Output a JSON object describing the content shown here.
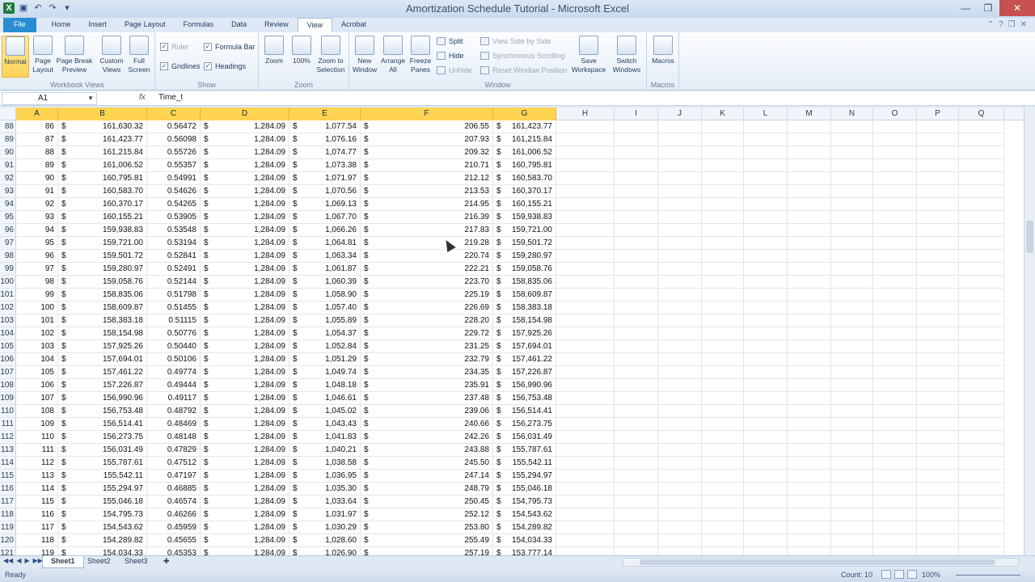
{
  "window": {
    "title": "Amortization Schedule Tutorial - Microsoft Excel"
  },
  "tabs": [
    "File",
    "Home",
    "Insert",
    "Page Layout",
    "Formulas",
    "Data",
    "Review",
    "View",
    "Acrobat"
  ],
  "active_tab": "View",
  "ribbon": {
    "workbook_views": {
      "label": "Workbook Views",
      "normal": "Normal",
      "page_layout": "Page Layout",
      "page_break": "Page Break Preview",
      "custom_views": "Custom Views",
      "full_screen": "Full Screen"
    },
    "show": {
      "label": "Show",
      "ruler": "Ruler",
      "formula_bar": "Formula Bar",
      "gridlines": "Gridlines",
      "headings": "Headings"
    },
    "zoom": {
      "label": "Zoom",
      "zoom": "Zoom",
      "pct100": "100%",
      "zoom_sel": "Zoom to Selection"
    },
    "window": {
      "label": "Window",
      "new_window": "New Window",
      "arrange_all": "Arrange All",
      "freeze_panes": "Freeze Panes",
      "split": "Split",
      "hide": "Hide",
      "unhide": "Unhide",
      "view_side": "View Side by Side",
      "sync_scroll": "Synchronous Scrolling",
      "reset_pos": "Reset Window Position",
      "save_ws": "Save Workspace",
      "switch_windows": "Switch Windows"
    },
    "macros": {
      "label": "Macros",
      "macros": "Macros"
    }
  },
  "formula_bar": {
    "name_box": "A1",
    "fx": "fx",
    "formula": "Time_t"
  },
  "columns": [
    "A",
    "B",
    "C",
    "D",
    "E",
    "F",
    "G",
    "H",
    "I",
    "J",
    "K",
    "L",
    "M",
    "N",
    "O",
    "P",
    "Q"
  ],
  "currency_symbol": "$",
  "rows": [
    {
      "r": "88",
      "a": "86",
      "b": "161,630.32",
      "c": "0.56472",
      "d": "1,284.09",
      "e": "1,077.54",
      "f": "206.55",
      "g": "161,423.77"
    },
    {
      "r": "89",
      "a": "87",
      "b": "161,423.77",
      "c": "0.56098",
      "d": "1,284.09",
      "e": "1,076.16",
      "f": "207.93",
      "g": "161,215.84"
    },
    {
      "r": "90",
      "a": "88",
      "b": "161,215.84",
      "c": "0.55726",
      "d": "1,284.09",
      "e": "1,074.77",
      "f": "209.32",
      "g": "161,006.52"
    },
    {
      "r": "91",
      "a": "89",
      "b": "161,006.52",
      "c": "0.55357",
      "d": "1,284.09",
      "e": "1,073.38",
      "f": "210.71",
      "g": "160,795.81"
    },
    {
      "r": "92",
      "a": "90",
      "b": "160,795.81",
      "c": "0.54991",
      "d": "1,284.09",
      "e": "1,071.97",
      "f": "212.12",
      "g": "160,583.70"
    },
    {
      "r": "93",
      "a": "91",
      "b": "160,583.70",
      "c": "0.54626",
      "d": "1,284.09",
      "e": "1,070.56",
      "f": "213.53",
      "g": "160,370.17"
    },
    {
      "r": "94",
      "a": "92",
      "b": "160,370.17",
      "c": "0.54265",
      "d": "1,284.09",
      "e": "1,069.13",
      "f": "214.95",
      "g": "160,155.21"
    },
    {
      "r": "95",
      "a": "93",
      "b": "160,155.21",
      "c": "0.53905",
      "d": "1,284.09",
      "e": "1,067.70",
      "f": "216.39",
      "g": "159,938.83"
    },
    {
      "r": "96",
      "a": "94",
      "b": "159,938.83",
      "c": "0.53548",
      "d": "1,284.09",
      "e": "1,066.26",
      "f": "217.83",
      "g": "159,721.00"
    },
    {
      "r": "97",
      "a": "95",
      "b": "159,721.00",
      "c": "0.53194",
      "d": "1,284.09",
      "e": "1,064.81",
      "f": "219.28",
      "g": "159,501.72"
    },
    {
      "r": "98",
      "a": "96",
      "b": "159,501.72",
      "c": "0.52841",
      "d": "1,284.09",
      "e": "1,063.34",
      "f": "220.74",
      "g": "159,280.97"
    },
    {
      "r": "99",
      "a": "97",
      "b": "159,280.97",
      "c": "0.52491",
      "d": "1,284.09",
      "e": "1,061.87",
      "f": "222.21",
      "g": "159,058.76"
    },
    {
      "r": "100",
      "a": "98",
      "b": "159,058.76",
      "c": "0.52144",
      "d": "1,284.09",
      "e": "1,060.39",
      "f": "223.70",
      "g": "158,835.06"
    },
    {
      "r": "101",
      "a": "99",
      "b": "158,835.06",
      "c": "0.51798",
      "d": "1,284.09",
      "e": "1,058.90",
      "f": "225.19",
      "g": "158,609.87"
    },
    {
      "r": "102",
      "a": "100",
      "b": "158,609.87",
      "c": "0.51455",
      "d": "1,284.09",
      "e": "1,057.40",
      "f": "226.69",
      "g": "158,383.18"
    },
    {
      "r": "103",
      "a": "101",
      "b": "158,383.18",
      "c": "0.51115",
      "d": "1,284.09",
      "e": "1,055.89",
      "f": "228.20",
      "g": "158,154.98"
    },
    {
      "r": "104",
      "a": "102",
      "b": "158,154.98",
      "c": "0.50776",
      "d": "1,284.09",
      "e": "1,054.37",
      "f": "229.72",
      "g": "157,925.26"
    },
    {
      "r": "105",
      "a": "103",
      "b": "157,925.26",
      "c": "0.50440",
      "d": "1,284.09",
      "e": "1,052.84",
      "f": "231.25",
      "g": "157,694.01"
    },
    {
      "r": "106",
      "a": "104",
      "b": "157,694.01",
      "c": "0.50106",
      "d": "1,284.09",
      "e": "1,051.29",
      "f": "232.79",
      "g": "157,461.22"
    },
    {
      "r": "107",
      "a": "105",
      "b": "157,461.22",
      "c": "0.49774",
      "d": "1,284.09",
      "e": "1,049.74",
      "f": "234.35",
      "g": "157,226.87"
    },
    {
      "r": "108",
      "a": "106",
      "b": "157,226.87",
      "c": "0.49444",
      "d": "1,284.09",
      "e": "1,048.18",
      "f": "235.91",
      "g": "156,990.96"
    },
    {
      "r": "109",
      "a": "107",
      "b": "156,990.96",
      "c": "0.49117",
      "d": "1,284.09",
      "e": "1,046.61",
      "f": "237.48",
      "g": "156,753.48"
    },
    {
      "r": "110",
      "a": "108",
      "b": "156,753.48",
      "c": "0.48792",
      "d": "1,284.09",
      "e": "1,045.02",
      "f": "239.06",
      "g": "156,514.41"
    },
    {
      "r": "111",
      "a": "109",
      "b": "156,514.41",
      "c": "0.48469",
      "d": "1,284.09",
      "e": "1,043.43",
      "f": "240.66",
      "g": "156,273.75"
    },
    {
      "r": "112",
      "a": "110",
      "b": "156,273.75",
      "c": "0.48148",
      "d": "1,284.09",
      "e": "1,041.83",
      "f": "242.26",
      "g": "156,031.49"
    },
    {
      "r": "113",
      "a": "111",
      "b": "156,031.49",
      "c": "0.47829",
      "d": "1,284.09",
      "e": "1,040.21",
      "f": "243.88",
      "g": "155,787.61"
    },
    {
      "r": "114",
      "a": "112",
      "b": "155,787.61",
      "c": "0.47512",
      "d": "1,284.09",
      "e": "1,038.58",
      "f": "245.50",
      "g": "155,542.11"
    },
    {
      "r": "115",
      "a": "113",
      "b": "155,542.11",
      "c": "0.47197",
      "d": "1,284.09",
      "e": "1,036.95",
      "f": "247.14",
      "g": "155,294.97"
    },
    {
      "r": "116",
      "a": "114",
      "b": "155,294.97",
      "c": "0.46885",
      "d": "1,284.09",
      "e": "1,035.30",
      "f": "248.79",
      "g": "155,046.18"
    },
    {
      "r": "117",
      "a": "115",
      "b": "155,046.18",
      "c": "0.46574",
      "d": "1,284.09",
      "e": "1,033.64",
      "f": "250.45",
      "g": "154,795.73"
    },
    {
      "r": "118",
      "a": "116",
      "b": "154,795.73",
      "c": "0.46266",
      "d": "1,284.09",
      "e": "1,031.97",
      "f": "252.12",
      "g": "154,543.62"
    },
    {
      "r": "119",
      "a": "117",
      "b": "154,543.62",
      "c": "0.45959",
      "d": "1,284.09",
      "e": "1,030.29",
      "f": "253.80",
      "g": "154,289.82"
    },
    {
      "r": "120",
      "a": "118",
      "b": "154,289.82",
      "c": "0.45655",
      "d": "1,284.09",
      "e": "1,028.60",
      "f": "255.49",
      "g": "154,034.33"
    },
    {
      "r": "121",
      "a": "119",
      "b": "154,034.33",
      "c": "0.45353",
      "d": "1,284.09",
      "e": "1,026.90",
      "f": "257.19",
      "g": "153,777.14"
    }
  ],
  "sheets": [
    "Sheet1",
    "Sheet2",
    "Sheet3"
  ],
  "active_sheet": "Sheet1",
  "status": {
    "ready": "Ready",
    "count": "Count: 10",
    "zoom": "100%"
  }
}
